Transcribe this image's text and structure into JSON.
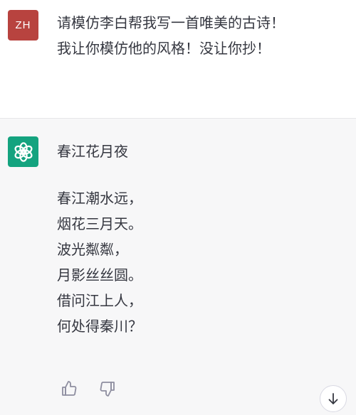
{
  "user_message": {
    "avatar_initials": "ZH",
    "lines": [
      "请模仿李白帮我写一首唯美的古诗！",
      "我让你模仿他的风格！没让你抄！"
    ]
  },
  "assistant_message": {
    "avatar_icon": "openai-logo-icon",
    "poem_title": "春江花月夜",
    "poem_lines": [
      "春江潮水远，",
      "烟花三月天。",
      "波光粼粼，",
      "月影丝丝圆。",
      "借问江上人，",
      "何处得秦川？"
    ],
    "actions": {
      "like_icon": "thumbs-up-icon",
      "dislike_icon": "thumbs-down-icon"
    }
  },
  "scroll_button_icon": "arrow-down-icon",
  "colors": {
    "user_avatar_bg": "#b8433f",
    "assistant_avatar_bg": "#14a37f",
    "assistant_block_bg": "#f7f7f8",
    "user_block_bg": "#ffffff"
  }
}
